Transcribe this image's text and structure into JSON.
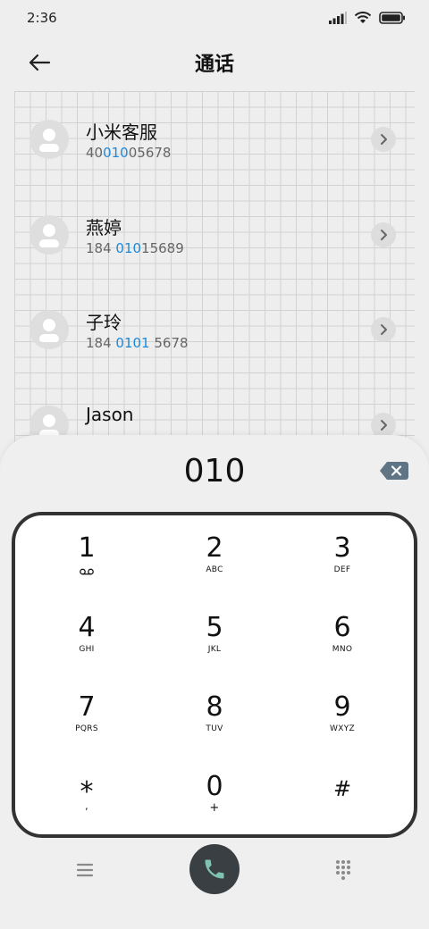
{
  "status_bar": {
    "time": "2:36",
    "icons": [
      "signal-icon",
      "wifi-icon",
      "battery-icon"
    ]
  },
  "header": {
    "title": "通话",
    "back_icon": "arrow-left-icon"
  },
  "contacts": [
    {
      "name": "小米客服",
      "number_parts": [
        "40",
        "010",
        "05678"
      ]
    },
    {
      "name": "燕婷",
      "number_parts": [
        "184 ",
        "010",
        "15689"
      ]
    },
    {
      "name": "子玲",
      "number_parts": [
        "184 ",
        "0101",
        " 5678"
      ]
    },
    {
      "name": "Jason",
      "number_parts": [
        "",
        "",
        ""
      ]
    }
  ],
  "dialer": {
    "input": "010",
    "keys": [
      {
        "digit": "1",
        "letters": ""
      },
      {
        "digit": "2",
        "letters": "ABC"
      },
      {
        "digit": "3",
        "letters": "DEF"
      },
      {
        "digit": "4",
        "letters": "GHI"
      },
      {
        "digit": "5",
        "letters": "JKL"
      },
      {
        "digit": "6",
        "letters": "MNO"
      },
      {
        "digit": "7",
        "letters": "PQRS"
      },
      {
        "digit": "8",
        "letters": "TUV"
      },
      {
        "digit": "9",
        "letters": "WXYZ"
      },
      {
        "digit": "*",
        "letters": ","
      },
      {
        "digit": "0",
        "letters": "+"
      },
      {
        "digit": "#",
        "letters": ""
      }
    ]
  },
  "colors": {
    "highlight": "#1e88d8",
    "call_button": "#3a3f43",
    "call_icon": "#7fc4b2",
    "keypad_border": "#333333"
  }
}
